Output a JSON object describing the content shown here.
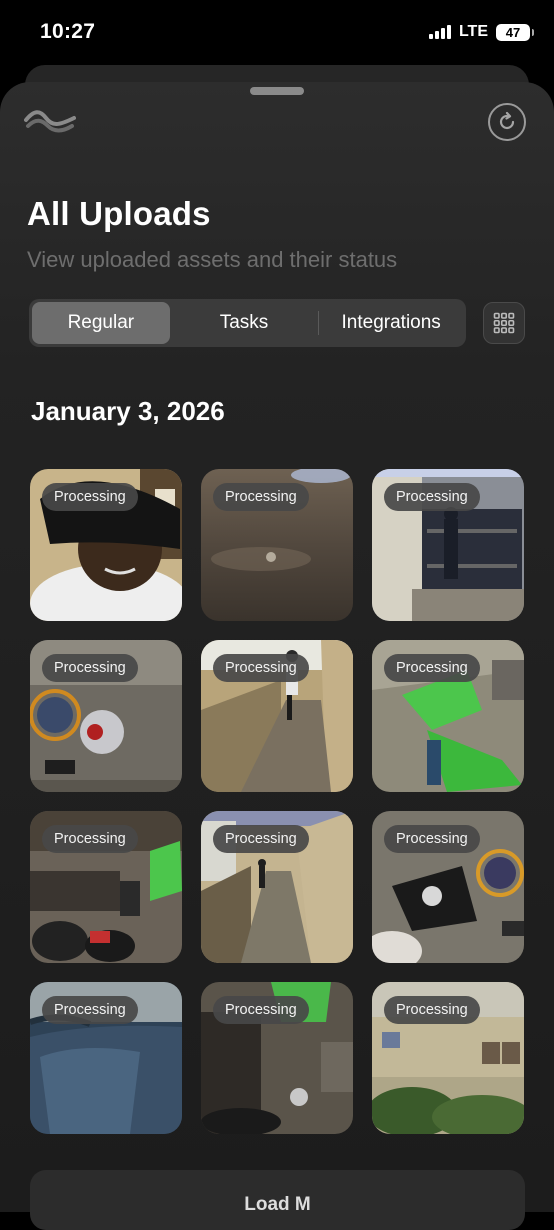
{
  "status_bar": {
    "time": "10:27",
    "network": "LTE",
    "battery": "47"
  },
  "header": {
    "title": "All Uploads",
    "subtitle": "View uploaded assets and their status"
  },
  "tabs": [
    {
      "label": "Regular",
      "active": true
    },
    {
      "label": "Tasks",
      "active": false
    },
    {
      "label": "Integrations",
      "active": false
    }
  ],
  "date_heading": "January 3, 2026",
  "uploads": [
    {
      "status": "Processing"
    },
    {
      "status": "Processing"
    },
    {
      "status": "Processing"
    },
    {
      "status": "Processing"
    },
    {
      "status": "Processing"
    },
    {
      "status": "Processing"
    },
    {
      "status": "Processing"
    },
    {
      "status": "Processing"
    },
    {
      "status": "Processing"
    },
    {
      "status": "Processing"
    },
    {
      "status": "Processing"
    },
    {
      "status": "Processing"
    }
  ],
  "load_more_label": "Load M",
  "icons": {
    "logo": "wave-logo-icon",
    "refresh": "refresh-icon",
    "grid": "grid-view-icon"
  }
}
